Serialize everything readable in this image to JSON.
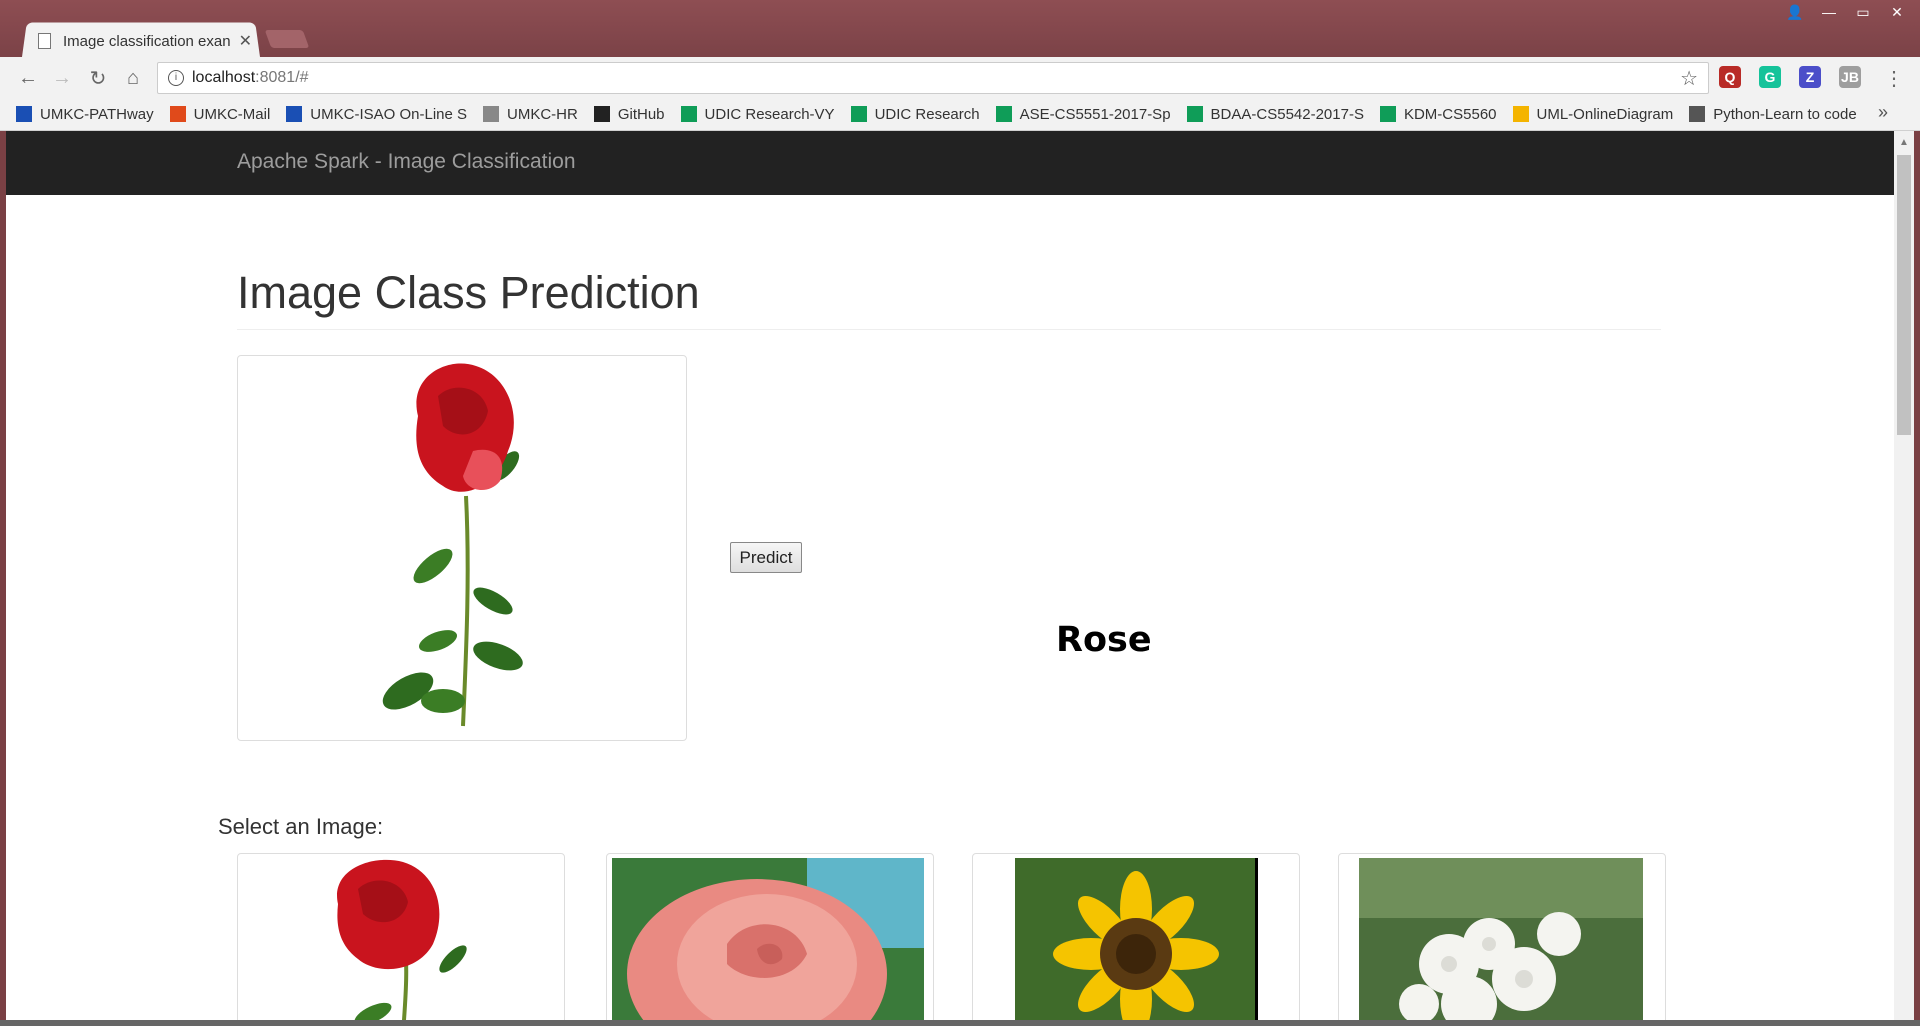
{
  "browser": {
    "tab_title": "Image classification exan",
    "url_host": "localhost",
    "url_rest": ":8081/#",
    "bookmarks": [
      {
        "label": "UMKC-PATHway",
        "color": "#1a4fb4"
      },
      {
        "label": "UMKC-Mail",
        "color": "#e04a1b"
      },
      {
        "label": "UMKC-ISAO On-Line S",
        "color": "#1a4fb4"
      },
      {
        "label": "UMKC-HR",
        "color": "#888888"
      },
      {
        "label": "GitHub",
        "color": "#222222"
      },
      {
        "label": "UDIC Research-VY",
        "color": "#0f9d58"
      },
      {
        "label": "UDIC Research",
        "color": "#0f9d58"
      },
      {
        "label": "ASE-CS5551-2017-Sp",
        "color": "#0f9d58"
      },
      {
        "label": "BDAA-CS5542-2017-S",
        "color": "#0f9d58"
      },
      {
        "label": "KDM-CS5560",
        "color": "#0f9d58"
      },
      {
        "label": "UML-OnlineDiagram",
        "color": "#f4b400"
      },
      {
        "label": "Python-Learn to code",
        "color": "#555555"
      }
    ],
    "more_bookmarks": "»",
    "extensions": [
      {
        "name": "quora-icon",
        "glyph": "Q",
        "color": "#b92b27"
      },
      {
        "name": "grammarly-icon",
        "glyph": "G",
        "color": "#15c39a"
      },
      {
        "name": "zotero-icon",
        "glyph": "Z",
        "color": "#4b4ec9"
      },
      {
        "name": "jb-icon",
        "glyph": "JB",
        "color": "#9e9e9e"
      }
    ]
  },
  "app": {
    "brand": "Apache Spark - Image Classification",
    "heading": "Image Class Prediction",
    "predict_label": "Predict",
    "result": "Rose",
    "select_label": "Select an Image:"
  }
}
